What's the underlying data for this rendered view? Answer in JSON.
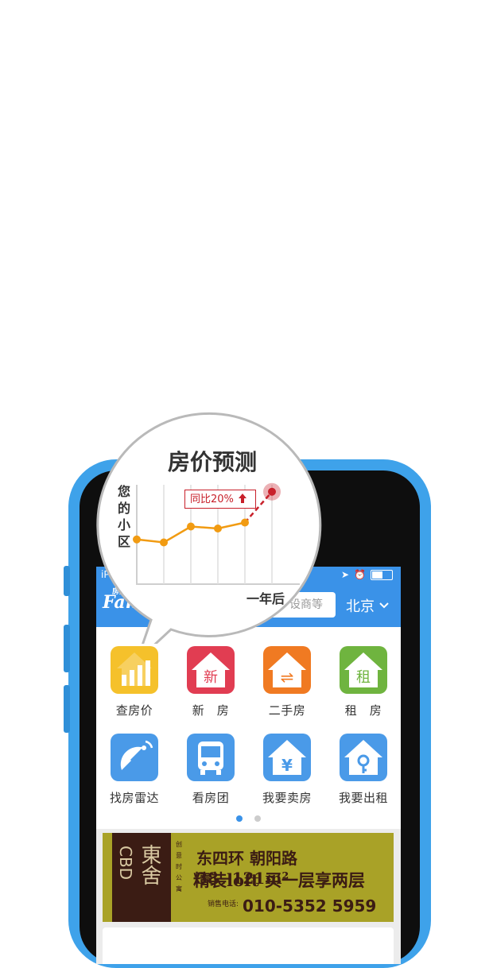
{
  "statusbar": {
    "carrier": "iPo"
  },
  "appbar": {
    "logo_small": "房天",
    "logo_text": "Fang",
    "search_placeholder": "设商等",
    "city": "北京",
    "brand_color": "#3a92e8"
  },
  "callout": {
    "title": "房价预测",
    "y_label": "您的小区",
    "x_label": "一年后",
    "tag": "同比20%",
    "tag_icon": "arrow-up-icon",
    "line_color": "#f19b12",
    "forecast_color": "#c8202a",
    "series": [
      {
        "x": 0,
        "y": 0.45
      },
      {
        "x": 1,
        "y": 0.42
      },
      {
        "x": 2,
        "y": 0.58
      },
      {
        "x": 3,
        "y": 0.56
      },
      {
        "x": 4,
        "y": 0.62
      },
      {
        "x": 5,
        "y": 0.93
      }
    ]
  },
  "grid": {
    "row1": [
      {
        "label": "查房价",
        "icon": "chart-house-icon",
        "color": "#f5c12b"
      },
      {
        "label": "新　房",
        "icon": "new-house-icon",
        "glyph": "新",
        "color": "#e13d52"
      },
      {
        "label": "二手房",
        "icon": "exchange-house-icon",
        "glyph": "⇌",
        "color": "#f07a22"
      },
      {
        "label": "租　房",
        "icon": "rent-house-icon",
        "glyph": "租",
        "color": "#6fb43f"
      }
    ],
    "row2": [
      {
        "label": "找房雷达",
        "icon": "radar-dish-icon",
        "glyph": "📡",
        "color": "#4a9ae8"
      },
      {
        "label": "看房团",
        "icon": "bus-icon",
        "glyph": "🚌",
        "color": "#4a9ae8"
      },
      {
        "label": "我要卖房",
        "icon": "yen-house-icon",
        "glyph": "¥",
        "color": "#4a9ae8"
      },
      {
        "label": "我要出租",
        "icon": "key-house-icon",
        "glyph": "⚷",
        "color": "#4a9ae8"
      }
    ]
  },
  "pager": {
    "active_color": "#3a92e8",
    "inactive_color": "#cccccc"
  },
  "banner": {
    "logo_letters": "CBD",
    "logo_chars": "東舍",
    "vertical_text": "创意时公寓",
    "line1": "东四环 朝阳路 38−121m²",
    "line2": "精装loft 买一层享两层",
    "phone_label": "销售电话:",
    "phone": "010-5352 5959"
  }
}
